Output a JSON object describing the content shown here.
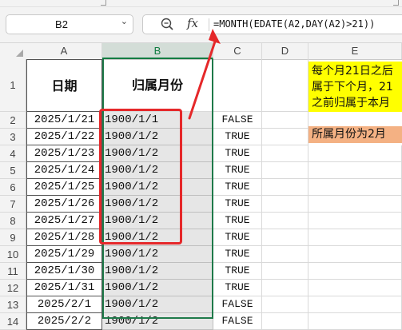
{
  "name_box": {
    "value": "B2"
  },
  "formula_bar": {
    "fx_label": "fx",
    "formula": "=MONTH(EDATE(A2,DAY(A2)>21))"
  },
  "columns": [
    "A",
    "B",
    "C",
    "D",
    "E"
  ],
  "selected_column": "B",
  "header_row": {
    "a": "日期",
    "b": "归属月份"
  },
  "rows": [
    {
      "row": "1"
    },
    {
      "row": "2",
      "a": "2025/1/21",
      "b": "1900/1/1",
      "c": "FALSE"
    },
    {
      "row": "3",
      "a": "2025/1/22",
      "b": "1900/1/2",
      "c": "TRUE"
    },
    {
      "row": "4",
      "a": "2025/1/23",
      "b": "1900/1/2",
      "c": "TRUE"
    },
    {
      "row": "5",
      "a": "2025/1/24",
      "b": "1900/1/2",
      "c": "TRUE"
    },
    {
      "row": "6",
      "a": "2025/1/25",
      "b": "1900/1/2",
      "c": "TRUE"
    },
    {
      "row": "7",
      "a": "2025/1/26",
      "b": "1900/1/2",
      "c": "TRUE"
    },
    {
      "row": "8",
      "a": "2025/1/27",
      "b": "1900/1/2",
      "c": "TRUE"
    },
    {
      "row": "9",
      "a": "2025/1/28",
      "b": "1900/1/2",
      "c": "TRUE"
    },
    {
      "row": "10",
      "a": "2025/1/29",
      "b": "1900/1/2",
      "c": "TRUE"
    },
    {
      "row": "11",
      "a": "2025/1/30",
      "b": "1900/1/2",
      "c": "TRUE"
    },
    {
      "row": "12",
      "a": "2025/1/31",
      "b": "1900/1/2",
      "c": "TRUE"
    },
    {
      "row": "13",
      "a": "2025/2/1",
      "b": "1900/1/2",
      "c": "FALSE"
    },
    {
      "row": "14",
      "a": "2025/2/2",
      "b": "1900/1/2",
      "c": "FALSE"
    }
  ],
  "notes": {
    "yellow_lines": [
      "每个月21日之后",
      "属于下个月，21",
      "之前归属于本月"
    ],
    "orange": "所属月份为2月"
  },
  "colors": {
    "accent_green": "#107c41",
    "annotation_red": "#e5282a",
    "note_yellow": "#ffff00",
    "note_orange": "#f4b183"
  },
  "icons": [
    "chevron-down-icon",
    "zoom-icon",
    "fx-icon",
    "select-all-icon"
  ]
}
